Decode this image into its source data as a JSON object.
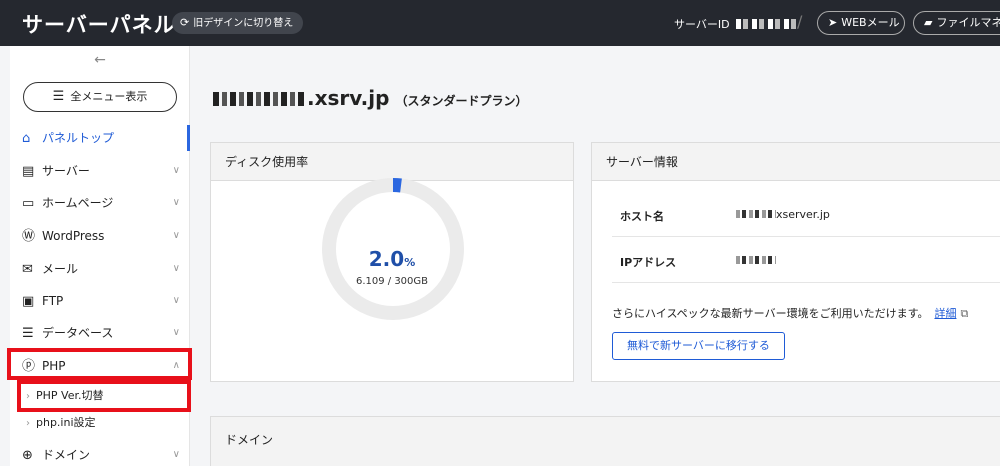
{
  "header": {
    "title": "サーバーパネル",
    "design_toggle": "旧デザインに切り替え",
    "server_id_label": "サーバーID",
    "divider": "/",
    "webmail": "WEBメール",
    "filemanager": "ファイルマネ"
  },
  "sidebar": {
    "collapse": "←",
    "all_menu": "全メニュー表示",
    "items": [
      {
        "label": "パネルトップ",
        "icon": "home-icon",
        "glyph": "⌂"
      },
      {
        "label": "サーバー",
        "icon": "server-icon",
        "glyph": "▤"
      },
      {
        "label": "ホームページ",
        "icon": "browser-icon",
        "glyph": "▭"
      },
      {
        "label": "WordPress",
        "icon": "wordpress-icon",
        "glyph": "Ⓦ"
      },
      {
        "label": "メール",
        "icon": "mail-icon",
        "glyph": "✉"
      },
      {
        "label": "FTP",
        "icon": "ftp-icon",
        "glyph": "▣"
      },
      {
        "label": "データベース",
        "icon": "database-icon",
        "glyph": "☰"
      },
      {
        "label": "PHP",
        "icon": "php-icon",
        "glyph": "ⓟ"
      }
    ],
    "php_sub": [
      "PHP Ver.切替",
      "php.ini設定"
    ],
    "domain_item": {
      "label": "ドメイン",
      "icon": "globe-icon",
      "glyph": "⊕"
    }
  },
  "main": {
    "domain_suffix": ".xsrv.jp",
    "plan": "（スタンダードプラン）",
    "disk": {
      "title": "ディスク使用率",
      "percent_value": "2.0",
      "percent_unit": "%",
      "usage_fraction": 0.02,
      "usage": "6.109 / 300GB"
    },
    "server_info": {
      "title": "サーバー情報",
      "host_label": "ホスト名",
      "host_value": "xserver.jp",
      "ip_label": "IPアドレス",
      "promo": "さらにハイスペックな最新サーバー環境をご利用いただけます。",
      "promo_link": "詳細",
      "migrate_button": "無料で新サーバーに移行する"
    },
    "domain_panel_title": "ドメイン"
  },
  "colors": {
    "accent": "#1f5bd6",
    "highlight": "#e8101a",
    "header_bg": "#25282f"
  }
}
